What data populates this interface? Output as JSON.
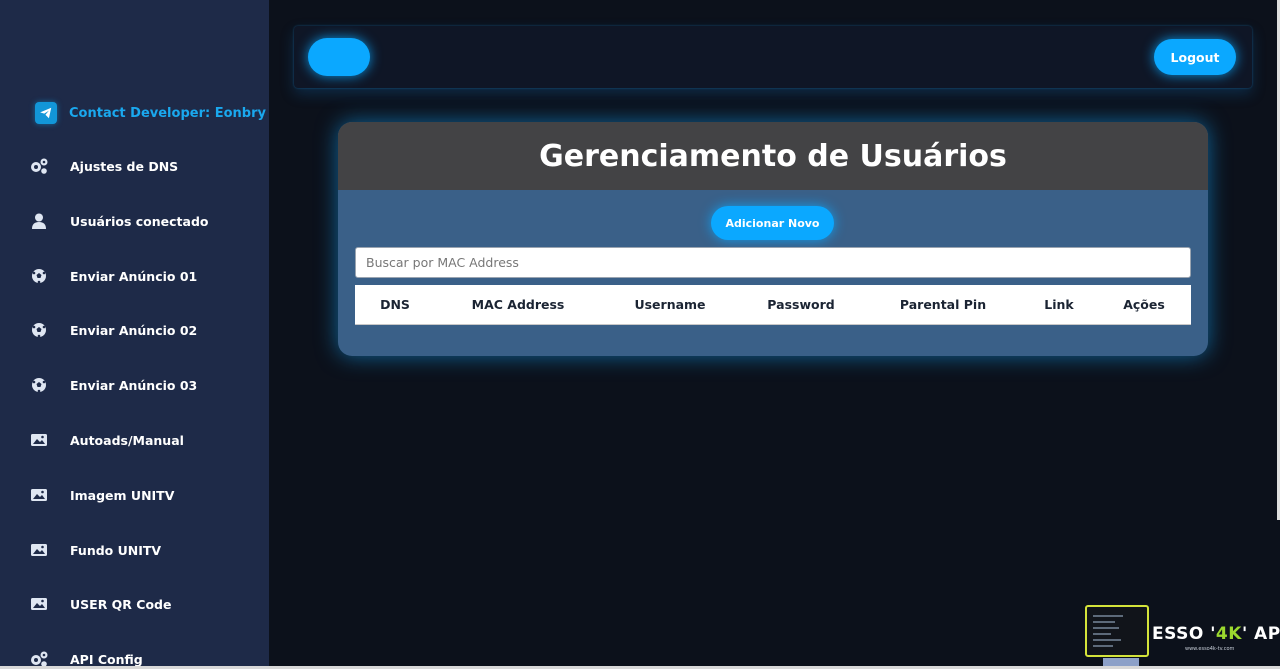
{
  "sidebar": {
    "contact_label": "Contact Developer: Eonbry",
    "items": [
      {
        "label": "Ajustes de DNS",
        "icon": "gears-icon"
      },
      {
        "label": "Usuários conectado",
        "icon": "user-icon"
      },
      {
        "label": "Enviar Anúncio 01",
        "icon": "soccer-ball-icon"
      },
      {
        "label": "Enviar Anúncio 02",
        "icon": "soccer-ball-icon"
      },
      {
        "label": "Enviar Anúncio 03",
        "icon": "soccer-ball-icon"
      },
      {
        "label": "Autoads/Manual",
        "icon": "image-icon"
      },
      {
        "label": "Imagem UNITV",
        "icon": "image-icon"
      },
      {
        "label": "Fundo UNITV",
        "icon": "image-icon"
      },
      {
        "label": "USER QR Code",
        "icon": "image-icon"
      },
      {
        "label": "API Config",
        "icon": "gears-icon"
      }
    ]
  },
  "topbar": {
    "logout_label": "Logout"
  },
  "card": {
    "title": "Gerenciamento de Usuários",
    "add_label": "Adicionar Novo",
    "search_placeholder": "Buscar por MAC Address",
    "columns": [
      "DNS",
      "MAC Address",
      "Username",
      "Password",
      "Parental Pin",
      "Link",
      "Ações"
    ]
  },
  "logo": {
    "text_pre": "ESSO '",
    "text_accent": "4K",
    "text_post": "' APPS",
    "url": "www.esso4k-tv.com"
  },
  "colors": {
    "accent": "#0ba8ff",
    "sidebar_bg": "#1e2a48",
    "card_bg": "#3a6088",
    "card_header_bg": "#434345",
    "page_bg": "#0c111b"
  }
}
